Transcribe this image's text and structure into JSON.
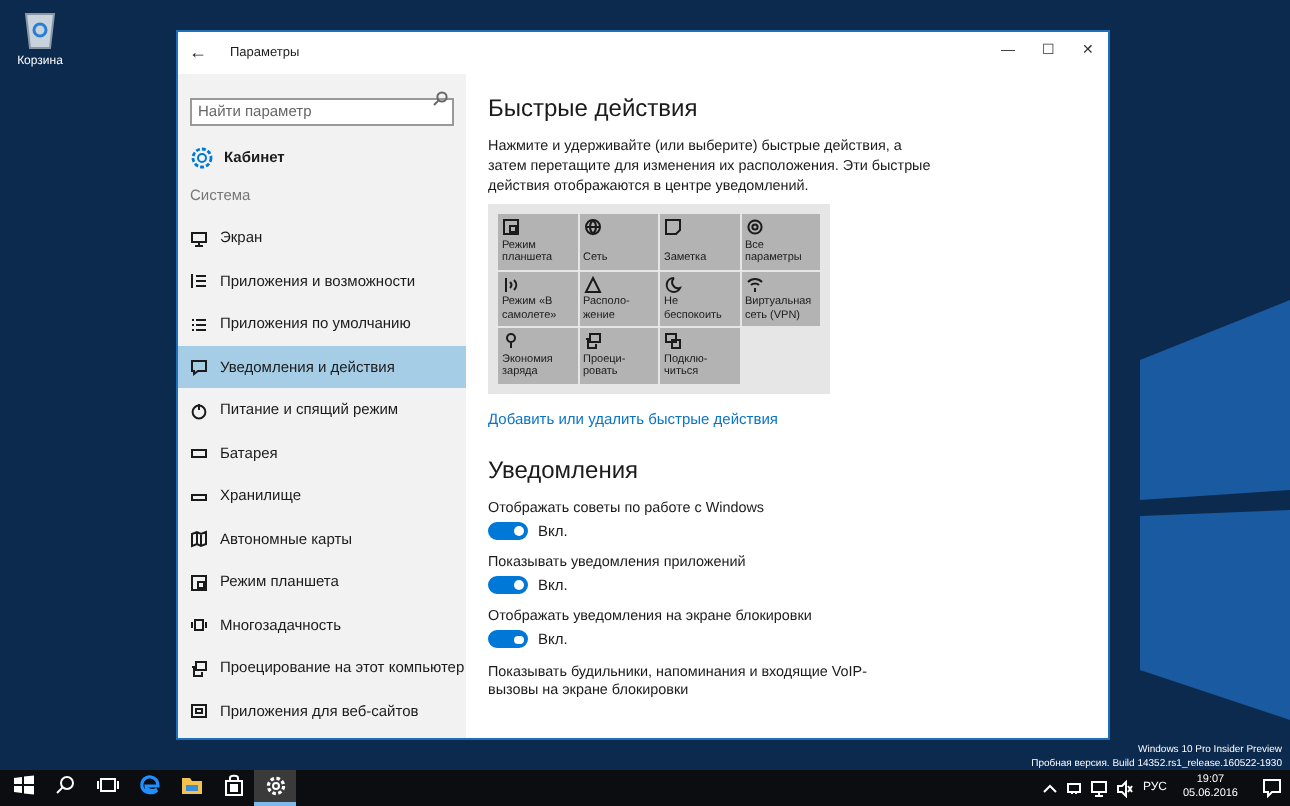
{
  "desktop": {
    "icons": [
      {
        "label": "Корзина"
      }
    ],
    "watermark_lines": [
      "Windows 10 Pro Insider Preview",
      "Пробная версия. Build 14352.rs1_release.160522-1930"
    ]
  },
  "window": {
    "title": "Параметры",
    "back": "←",
    "controls": [
      "—",
      "☐",
      "✕"
    ]
  },
  "sidebar": {
    "search": {
      "placeholder": "Найти параметр"
    },
    "home": "Кабинет",
    "section": "Система",
    "items": [
      {
        "label": "Экран",
        "selected": false
      },
      {
        "label": "Приложения и возможности",
        "selected": false
      },
      {
        "label": "Приложения по умолчанию",
        "selected": false
      },
      {
        "label": "Уведомления и действия",
        "selected": true
      },
      {
        "label": "Питание и спящий режим",
        "selected": false
      },
      {
        "label": "Батарея",
        "selected": false
      },
      {
        "label": "Хранилище",
        "selected": false
      },
      {
        "label": "Автономные карты",
        "selected": false
      },
      {
        "label": "Режим планшета",
        "selected": false
      },
      {
        "label": "Многозадачность",
        "selected": false
      },
      {
        "label": "Проецирование на этот компьютер",
        "selected": false
      },
      {
        "label": "Приложения для веб-сайтов",
        "selected": false
      }
    ]
  },
  "quick_actions": {
    "title": "Быстрые действия",
    "description": "Нажмите и удерживайте (или выберите) быстрые действия, а затем перетащите для изменения их расположения. Эти быстрые действия отображаются в центре уведомлений.",
    "tiles": [
      {
        "label": "Режим планшета"
      },
      {
        "label": "Сеть"
      },
      {
        "label": "Заметка"
      },
      {
        "label": "Все параметры"
      },
      {
        "label": "Режим «В самолете»"
      },
      {
        "label": "Располо-жение"
      },
      {
        "label": "Не беспокоить"
      },
      {
        "label": "Виртуальная сеть (VPN)"
      },
      {
        "label": "Экономия заряда"
      },
      {
        "label": "Проеци-ровать"
      },
      {
        "label": "Подклю-читься"
      }
    ],
    "link": "Добавить или удалить быстрые действия"
  },
  "notifications": {
    "title": "Уведомления",
    "toggles": [
      {
        "label": "Отображать советы по работе с Windows",
        "on": true,
        "state_text": "Вкл."
      },
      {
        "label": "Показывать уведомления приложений",
        "on": true,
        "state_text": "Вкл."
      },
      {
        "label": "Отображать уведомления на экране блокировки",
        "on": true,
        "state_text": "Вкл."
      },
      {
        "label": "Показывать будильники, напоминания и входящие VoIP-вызовы на экране блокировки"
      }
    ]
  },
  "taskbar": {
    "apps": [
      {
        "selected": false
      },
      {
        "selected": false
      },
      {
        "selected": false
      },
      {
        "selected": false
      },
      {
        "selected": false
      },
      {
        "selected": false
      },
      {
        "selected": true
      }
    ],
    "language": "РУС",
    "time": "19:07",
    "date": "05.06.2016"
  }
}
